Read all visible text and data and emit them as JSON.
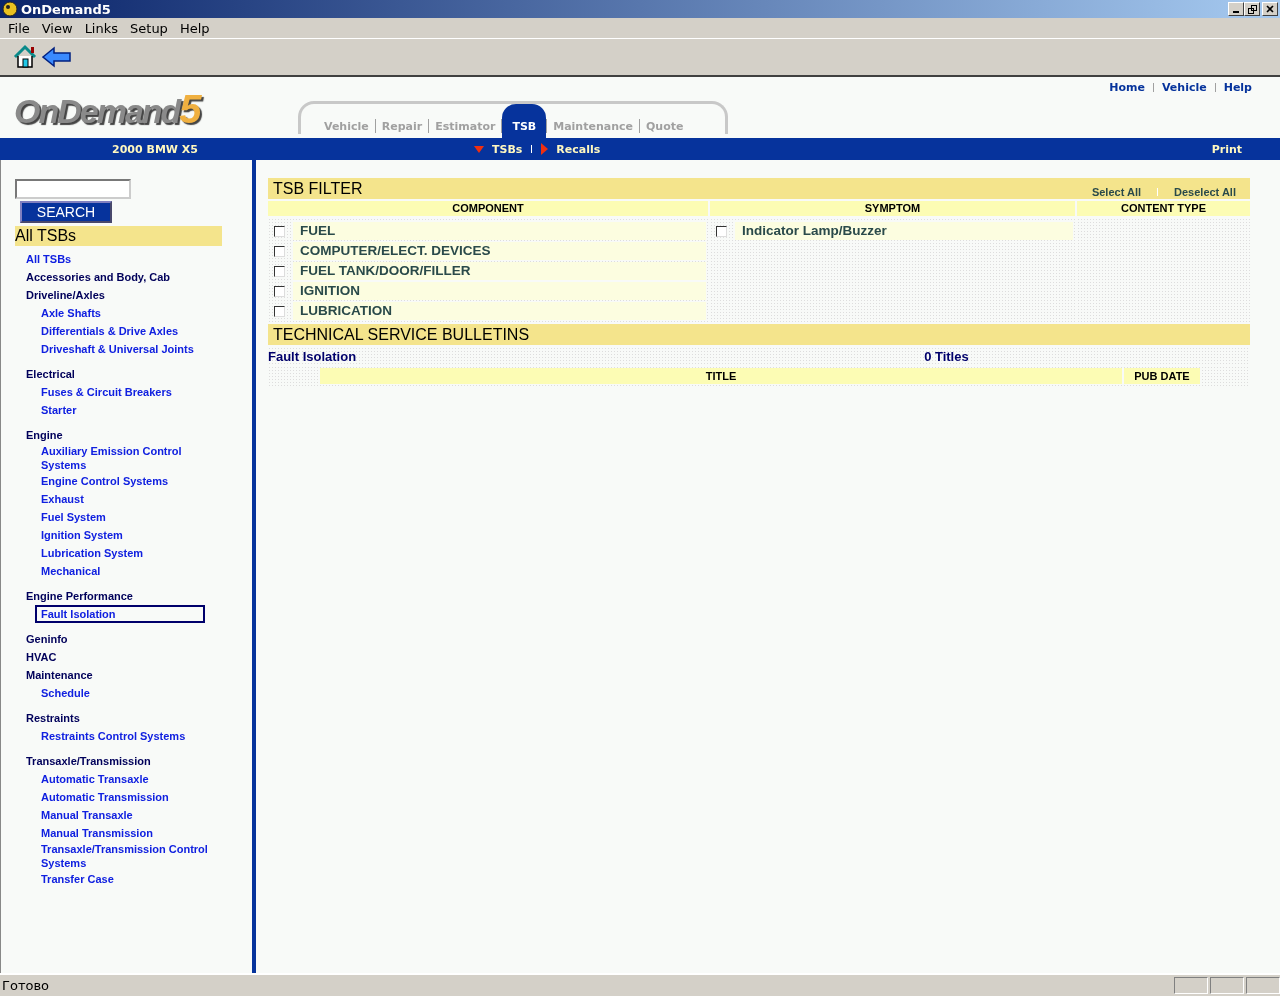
{
  "window": {
    "title": "OnDemand5"
  },
  "menu": [
    "File",
    "View",
    "Links",
    "Setup",
    "Help"
  ],
  "logo": {
    "text": "OnDemand",
    "number": "5"
  },
  "top_links": [
    "Home",
    "Vehicle",
    "Help"
  ],
  "tabs": [
    {
      "label": "Vehicle",
      "selected": false
    },
    {
      "label": "Repair",
      "selected": false
    },
    {
      "label": "Estimator",
      "selected": false
    },
    {
      "label": "TSB",
      "selected": true
    },
    {
      "label": "Maintenance",
      "selected": false
    },
    {
      "label": "Quote",
      "selected": false
    }
  ],
  "vehicle": "2000 BMW X5",
  "subnav": [
    {
      "label": "TSBs",
      "expanded": true
    },
    {
      "label": "Recalls",
      "expanded": false
    }
  ],
  "print": "Print",
  "search": {
    "button": "SEARCH"
  },
  "sidebar": {
    "title": "All TSBs",
    "items": [
      {
        "label": "All TSBs",
        "kind": "link",
        "selected": false
      },
      {
        "label": "Accessories and Body, Cab",
        "kind": "category",
        "selected": false
      },
      {
        "label": "Driveline/Axles",
        "kind": "category",
        "selected": false,
        "children": [
          {
            "label": "Axle Shafts",
            "selected": false
          },
          {
            "label": "Differentials & Drive Axles",
            "selected": false
          },
          {
            "label": "Driveshaft & Universal Joints",
            "selected": false
          }
        ]
      },
      {
        "label": "Electrical",
        "kind": "category",
        "selected": false,
        "children": [
          {
            "label": "Fuses & Circuit Breakers",
            "selected": false
          },
          {
            "label": "Starter",
            "selected": false
          }
        ]
      },
      {
        "label": "Engine",
        "kind": "category",
        "selected": false,
        "children": [
          {
            "label": "Auxiliary Emission Control Systems",
            "selected": false
          },
          {
            "label": "Engine Control Systems",
            "selected": false
          },
          {
            "label": "Exhaust",
            "selected": false
          },
          {
            "label": "Fuel System",
            "selected": false
          },
          {
            "label": "Ignition System",
            "selected": false
          },
          {
            "label": "Lubrication System",
            "selected": false
          },
          {
            "label": "Mechanical",
            "selected": false
          }
        ]
      },
      {
        "label": "Engine Performance",
        "kind": "category",
        "selected": false,
        "children": [
          {
            "label": "Fault Isolation",
            "selected": true
          }
        ]
      },
      {
        "label": "Geninfo",
        "kind": "category",
        "selected": false
      },
      {
        "label": "HVAC",
        "kind": "category",
        "selected": false
      },
      {
        "label": "Maintenance",
        "kind": "category",
        "selected": false,
        "children": [
          {
            "label": "Schedule",
            "selected": false
          }
        ]
      },
      {
        "label": "Restraints",
        "kind": "category",
        "selected": false,
        "children": [
          {
            "label": "Restraints Control Systems",
            "selected": false
          }
        ]
      },
      {
        "label": "Transaxle/Transmission",
        "kind": "category",
        "selected": false,
        "children": [
          {
            "label": "Automatic Transaxle",
            "selected": false
          },
          {
            "label": "Automatic Transmission",
            "selected": false
          },
          {
            "label": "Manual Transaxle",
            "selected": false
          },
          {
            "label": "Manual Transmission",
            "selected": false
          },
          {
            "label": "Transaxle/Transmission Control Systems",
            "selected": false
          },
          {
            "label": "Transfer Case",
            "selected": false
          }
        ]
      }
    ]
  },
  "filter": {
    "title": "TSB FILTER",
    "actions": [
      "Select All",
      "Deselect All"
    ],
    "columns": [
      "COMPONENT",
      "SYMPTOM",
      "CONTENT TYPE"
    ],
    "components": [
      {
        "label": "FUEL",
        "checked": false
      },
      {
        "label": "COMPUTER/ELECT. DEVICES",
        "checked": false
      },
      {
        "label": "FUEL TANK/DOOR/FILLER",
        "checked": false
      },
      {
        "label": "IGNITION",
        "checked": false
      },
      {
        "label": "LUBRICATION",
        "checked": false
      }
    ],
    "symptoms": [
      {
        "label": "Indicator Lamp/Buzzer",
        "checked": false
      }
    ]
  },
  "bulletins": {
    "title": "TECHNICAL SERVICE BULLETINS",
    "category": "Fault Isolation",
    "count": "0 Titles",
    "columns": [
      "TITLE",
      "PUB DATE"
    ]
  },
  "status_bar": {
    "text": "Готово"
  }
}
